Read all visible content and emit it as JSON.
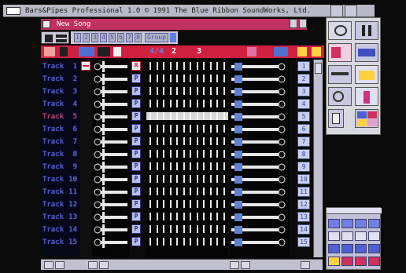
{
  "window": {
    "title": "Bars&Pipes Professional 1.0  © 1991 The Blue Ribbon SoundWorks, Ltd."
  },
  "song": {
    "name": "New Song"
  },
  "toolbar": {
    "group_numbers": [
      "1",
      "2",
      "3",
      "4",
      "5",
      "6",
      "7",
      "8"
    ],
    "group_label": "Group"
  },
  "transport": {
    "time_signature": "4/4",
    "measure_start": "2",
    "measure_next": "3"
  },
  "tracks": [
    {
      "label": "Track",
      "num": "1"
    },
    {
      "label": "Track",
      "num": "2"
    },
    {
      "label": "Track",
      "num": "3"
    },
    {
      "label": "Track",
      "num": "4"
    },
    {
      "label": "Track",
      "num": "5"
    },
    {
      "label": "Track",
      "num": "6"
    },
    {
      "label": "Track",
      "num": "7"
    },
    {
      "label": "Track",
      "num": "8"
    },
    {
      "label": "Track",
      "num": "9"
    },
    {
      "label": "Track",
      "num": "10"
    },
    {
      "label": "Track",
      "num": "11"
    },
    {
      "label": "Track",
      "num": "12"
    },
    {
      "label": "Track",
      "num": "13"
    },
    {
      "label": "Track",
      "num": "14"
    },
    {
      "label": "Track",
      "num": "15"
    }
  ],
  "track_numbers": [
    "1",
    "2",
    "3",
    "4",
    "5",
    "6",
    "7",
    "8",
    "9",
    "10",
    "11",
    "12",
    "13",
    "14",
    "15"
  ],
  "pipe_buttons": {
    "record": "R",
    "play": "P"
  },
  "active_track_index": 4,
  "colors": {
    "accent_red": "#d02040",
    "track_blue": "#4a56c8",
    "panel_grey": "#c8c8d8"
  }
}
